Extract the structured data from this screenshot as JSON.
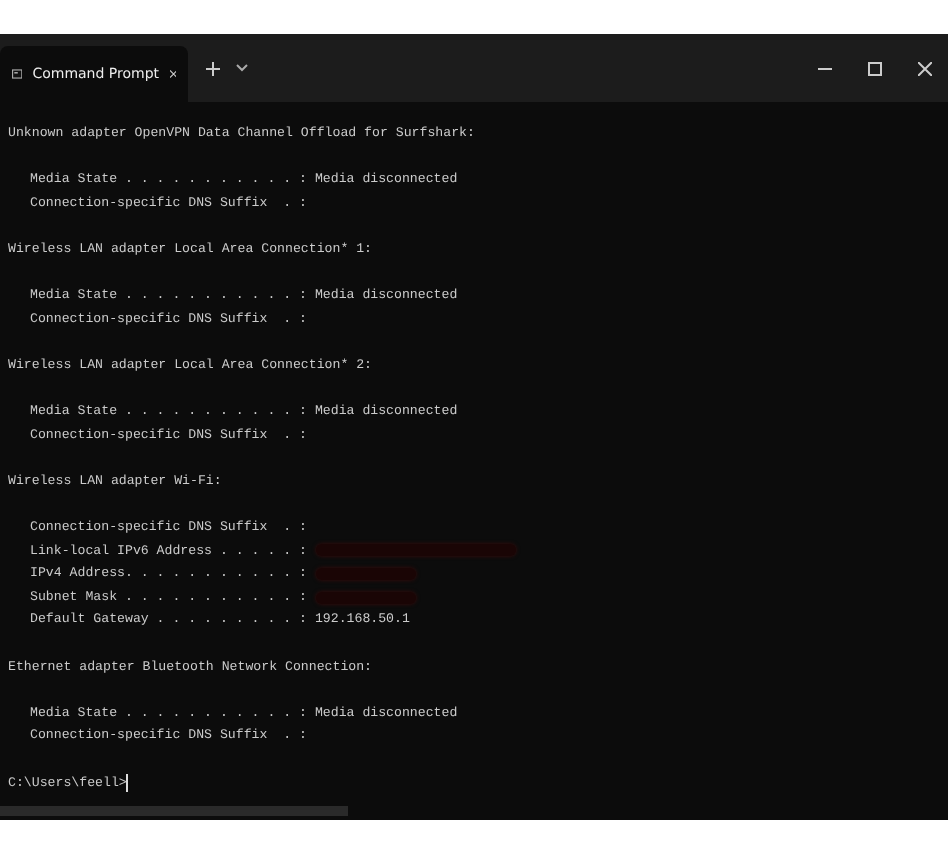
{
  "window": {
    "tab_title": "Command Prompt"
  },
  "sections": [
    {
      "title": "Unknown adapter OpenVPN Data Channel Offload for Surfshark:",
      "lines": [
        {
          "text": "Media State . . . . . . . . . . . : Media disconnected"
        },
        {
          "text": "Connection-specific DNS Suffix  . :"
        }
      ]
    },
    {
      "title": "Wireless LAN adapter Local Area Connection* 1:",
      "lines": [
        {
          "text": "Media State . . . . . . . . . . . : Media disconnected"
        },
        {
          "text": "Connection-specific DNS Suffix  . :"
        }
      ]
    },
    {
      "title": "Wireless LAN adapter Local Area Connection* 2:",
      "lines": [
        {
          "text": "Media State . . . . . . . . . . . : Media disconnected"
        },
        {
          "text": "Connection-specific DNS Suffix  . :"
        }
      ]
    },
    {
      "title": "Wireless LAN adapter Wi-Fi:",
      "lines": [
        {
          "text": "Connection-specific DNS Suffix  . :"
        },
        {
          "text": "Link-local IPv6 Address . . . . . :",
          "redacted": true
        },
        {
          "text": "IPv4 Address. . . . . . . . . . . :",
          "redacted": true
        },
        {
          "text": "Subnet Mask . . . . . . . . . . . :",
          "redacted": true
        },
        {
          "text": "Default Gateway . . . . . . . . . : 192.168.50.1"
        }
      ]
    },
    {
      "title": "Ethernet adapter Bluetooth Network Connection:",
      "lines": [
        {
          "text": "Media State . . . . . . . . . . . : Media disconnected"
        },
        {
          "text": "Connection-specific DNS Suffix  . :"
        }
      ]
    }
  ],
  "prompt": "C:\\Users\\feell>"
}
